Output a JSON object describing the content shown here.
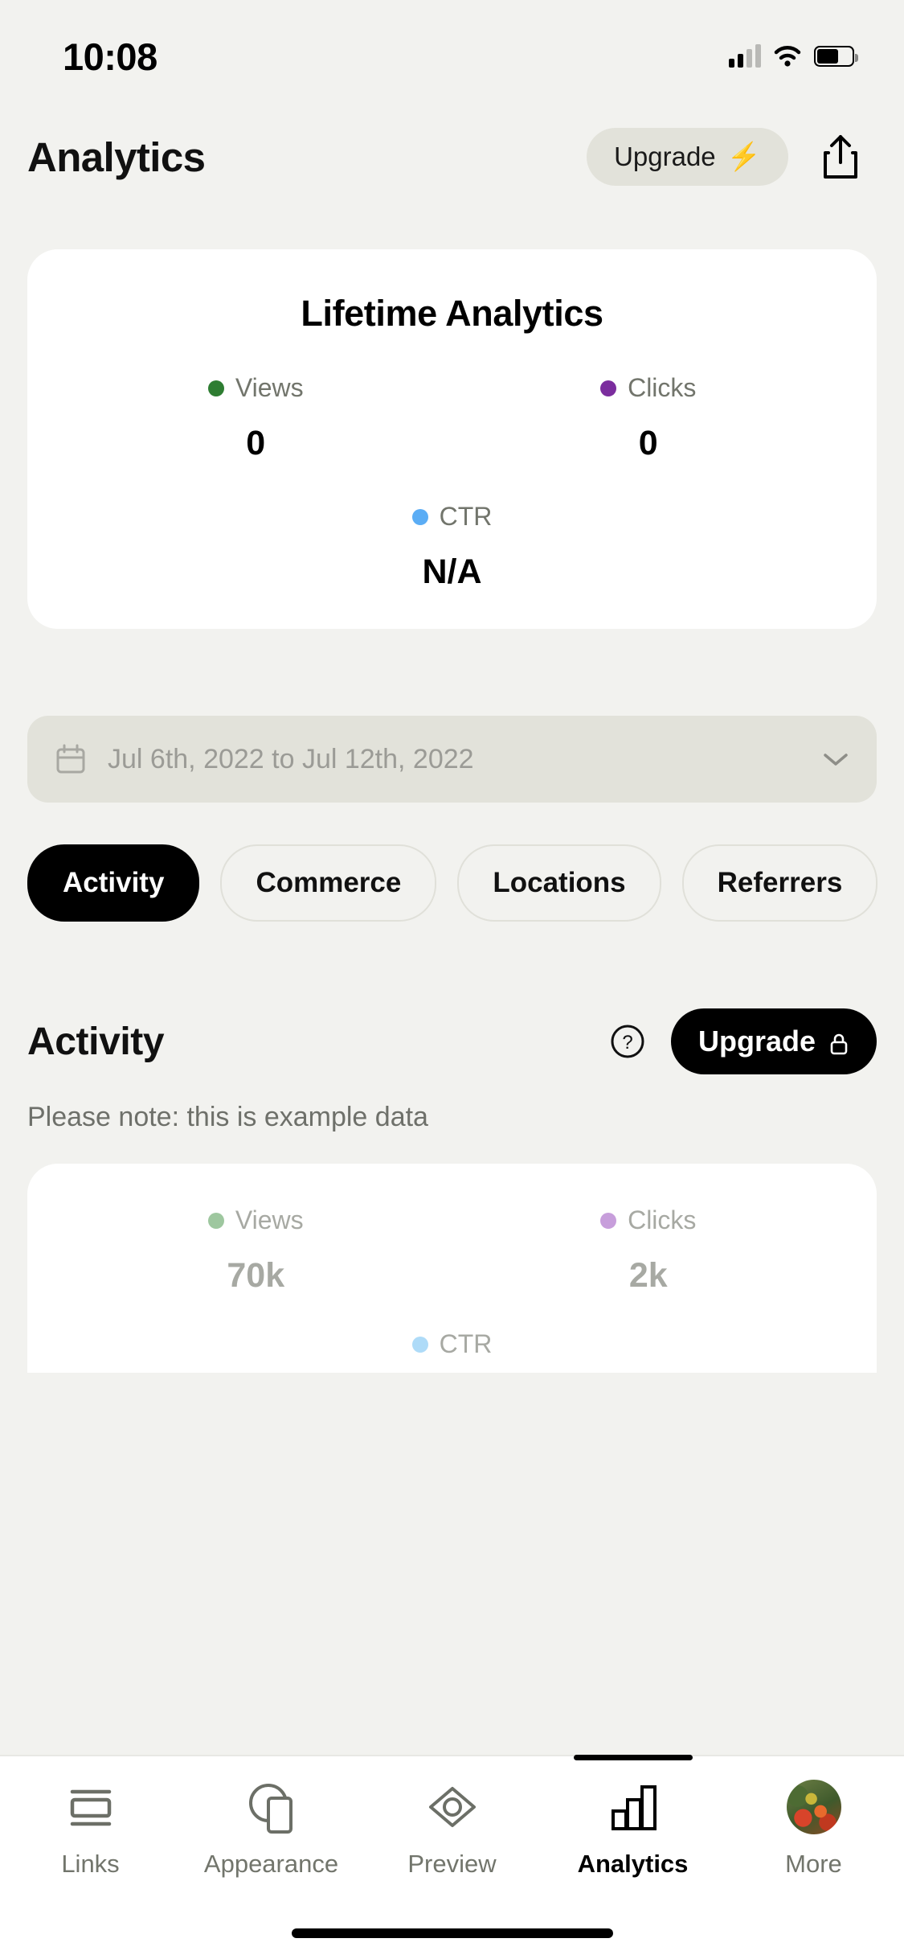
{
  "status_bar": {
    "time": "10:08",
    "cellular_icon": "cellular-signal-icon",
    "wifi_icon": "wifi-icon",
    "battery_icon": "battery-icon"
  },
  "header": {
    "title": "Analytics",
    "upgrade_label": "Upgrade",
    "upgrade_icon": "lightning-bolt-icon",
    "share_icon": "share-upload-icon"
  },
  "lifetime_card": {
    "title": "Lifetime Analytics",
    "metrics": [
      {
        "label": "Views",
        "value": "0",
        "color": "#2E7D32",
        "dot_icon": "views-dot-icon"
      },
      {
        "label": "Clicks",
        "value": "0",
        "color": "#7B2D9E",
        "dot_icon": "clicks-dot-icon"
      },
      {
        "label": "CTR",
        "value": "N/A",
        "color": "#5BADF5",
        "dot_icon": "ctr-dot-icon"
      }
    ]
  },
  "date_picker": {
    "icon": "calendar-icon",
    "value": "Jul 6th, 2022 to Jul 12th, 2022",
    "chevron_icon": "chevron-down-icon"
  },
  "tabs": [
    {
      "label": "Activity",
      "active": true
    },
    {
      "label": "Commerce",
      "active": false
    },
    {
      "label": "Locations",
      "active": false
    },
    {
      "label": "Referrers",
      "active": false
    }
  ],
  "activity": {
    "title": "Activity",
    "help_icon": "question-mark-circle-icon",
    "upgrade_label": "Upgrade",
    "upgrade_icon": "lock-icon",
    "note": "Please note: this is example data",
    "example_metrics": [
      {
        "label": "Views",
        "value": "70k",
        "color": "#9EC79F",
        "dot_icon": "views-dot-icon"
      },
      {
        "label": "Clicks",
        "value": "2k",
        "color": "#C79EDB",
        "dot_icon": "clicks-dot-icon"
      },
      {
        "label": "CTR",
        "value": "",
        "color": "#AEDBF8",
        "dot_icon": "ctr-dot-icon"
      }
    ]
  },
  "bottom_nav": [
    {
      "label": "Links",
      "icon": "links-icon",
      "active": false
    },
    {
      "label": "Appearance",
      "icon": "appearance-icon",
      "active": false
    },
    {
      "label": "Preview",
      "icon": "eye-preview-icon",
      "active": false
    },
    {
      "label": "Analytics",
      "icon": "bar-chart-icon",
      "active": true
    },
    {
      "label": "More",
      "icon": "avatar-icon",
      "active": false
    }
  ],
  "chart_data": {
    "type": "bar",
    "title": "Lifetime Analytics",
    "categories": [
      "Views",
      "Clicks",
      "CTR"
    ],
    "values": [
      0,
      0,
      null
    ],
    "value_labels": [
      "0",
      "0",
      "N/A"
    ],
    "series": [
      {
        "name": "Lifetime",
        "values": [
          0,
          0,
          null
        ],
        "labels": [
          "0",
          "0",
          "N/A"
        ]
      },
      {
        "name": "Activity (example data)",
        "values": [
          70000,
          2000,
          null
        ],
        "labels": [
          "70k",
          "2k",
          ""
        ]
      }
    ],
    "colors": [
      "#2E7D32",
      "#7B2D9E",
      "#5BADF5"
    ],
    "date_range": "Jul 6th, 2022 to Jul 12th, 2022",
    "xlabel": "",
    "ylabel": "",
    "legend_position": "inline"
  }
}
